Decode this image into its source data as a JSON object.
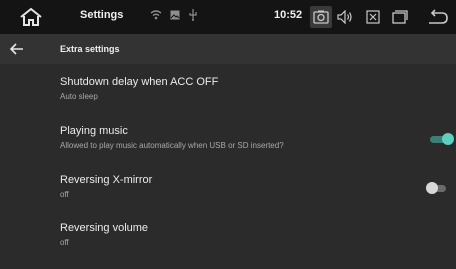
{
  "statusbar": {
    "title": "Settings",
    "time": "10:52",
    "icons": {
      "home": "home-icon",
      "wifi": "wifi-icon",
      "image": "image-icon",
      "usb": "usb-icon",
      "screenshot": "camera-icon",
      "volume": "volume-icon",
      "close": "close-box-icon",
      "window": "window-icon",
      "back": "return-icon"
    }
  },
  "header": {
    "title": "Extra settings"
  },
  "settings": [
    {
      "title": "Shutdown delay when ACC OFF",
      "subtitle": "Auto sleep"
    },
    {
      "title": "Playing music",
      "subtitle": "Allowed to play music automatically when USB or SD inserted?",
      "toggle": true
    },
    {
      "title": "Reversing X-mirror",
      "subtitle": "off",
      "toggle": false
    },
    {
      "title": "Reversing volume",
      "subtitle": "off"
    }
  ],
  "colors": {
    "accent": "#5fcfc0",
    "background": "#2b2b2b",
    "statusbar": "#141414"
  }
}
